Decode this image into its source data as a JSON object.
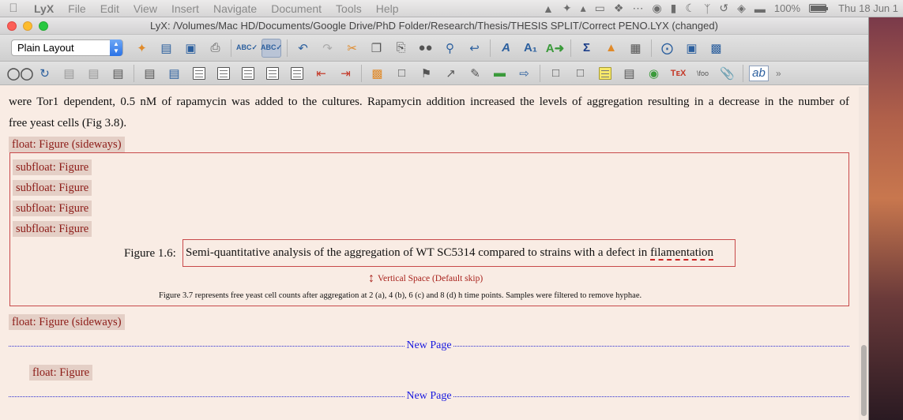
{
  "menubar": {
    "app": "LyX",
    "items": [
      "File",
      "Edit",
      "View",
      "Insert",
      "Navigate",
      "Document",
      "Tools",
      "Help"
    ],
    "battery": "100%",
    "clock": "Thu 18 Jun 1"
  },
  "window": {
    "title": "LyX: /Volumes/Mac HD/Documents/Google Drive/PhD Folder/Research/Thesis/THESIS SPLIT/Correct PENO.LYX (changed)"
  },
  "toolbar": {
    "layout_value": "Plain Layout"
  },
  "document": {
    "para_line1": "were Tor1 dependent, 0.5 nM of rapamycin was added to the cultures. Rapamycin addition increased the levels of aggregation resulting in a decrease in the number of",
    "para_line2": "free yeast cells (Fig 3.8).",
    "float_sideways_1": "float: Figure (sideways)",
    "subfloats": [
      "subfloat: Figure",
      "subfloat: Figure",
      "subfloat: Figure",
      "subfloat: Figure"
    ],
    "caption_label": "Figure 1.6:",
    "caption_text": "Semi-quantitative analysis of the aggregation of WT SC5314 compared to strains with a defect in",
    "caption_misspelt": "filamentation",
    "vspace_label": "Vertical Space (Default skip)",
    "small_caption": "Figure 3.7 represents free yeast cell counts after aggregation at 2 (a), 4 (b), 6 (c) and 8 (d) h time points. Samples were filtered to remove hyphae.",
    "float_sideways_2": "float: Figure (sideways)",
    "new_page": "New Page",
    "float_figure": "float: Figure"
  },
  "colors": {
    "doc_bg": "#f9ece4",
    "inset_bg": "#e4cfc6",
    "inset_text": "#8c1a16",
    "frame": "#c8494a",
    "newpage": "#1a1ae0"
  }
}
